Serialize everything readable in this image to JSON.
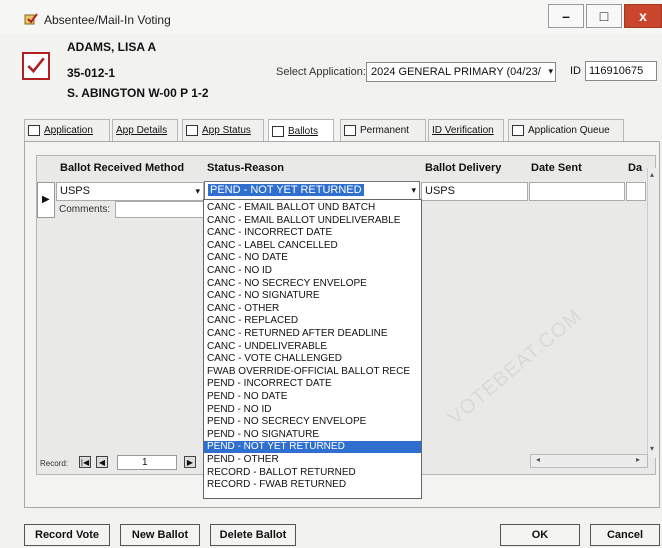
{
  "window": {
    "title": "Absentee/Mail-In Voting",
    "buttons": {
      "minimize": "–",
      "maximize": "□",
      "close": "x"
    }
  },
  "voter": {
    "name": "ADAMS, LISA A",
    "id": "35-012-1",
    "precinct": "S. ABINGTON W-00 P 1-2"
  },
  "application": {
    "select_label": "Select Application:",
    "selected": "2024 GENERAL PRIMARY (04/23/",
    "id_label": "ID",
    "id_value": "116910675"
  },
  "tabs": [
    {
      "label": "Application"
    },
    {
      "label": "App Details"
    },
    {
      "label": "App Status"
    },
    {
      "label": "Ballots"
    },
    {
      "label": "Permanent"
    },
    {
      "label": "ID Verification"
    },
    {
      "label": "Application Queue"
    }
  ],
  "grid": {
    "headers": [
      "Ballot Received Method",
      "Status-Reason",
      "Ballot Delivery",
      "Date Sent",
      "Da"
    ],
    "row": {
      "received_method": "USPS",
      "status_reason": "PEND - NOT YET RETURNED",
      "ballot_delivery": "USPS",
      "comments_label": "Comments:"
    }
  },
  "dropdown": {
    "items": [
      "CANC - EMAIL BALLOT UND BATCH",
      "CANC - EMAIL BALLOT UNDELIVERABLE",
      "CANC - INCORRECT DATE",
      "CANC - LABEL CANCELLED",
      "CANC - NO DATE",
      "CANC - NO ID",
      "CANC - NO SECRECY ENVELOPE",
      "CANC - NO SIGNATURE",
      "CANC - OTHER",
      "CANC - REPLACED",
      "CANC - RETURNED AFTER DEADLINE",
      "CANC - UNDELIVERABLE",
      "CANC - VOTE CHALLENGED",
      "FWAB OVERRIDE-OFFICIAL BALLOT RECE",
      "PEND - INCORRECT DATE",
      "PEND - NO DATE",
      "PEND - NO ID",
      "PEND - NO SECRECY ENVELOPE",
      "PEND - NO SIGNATURE",
      "PEND - NOT YET RETURNED",
      "PEND - OTHER",
      "RECORD - BALLOT RETURNED",
      "RECORD - FWAB RETURNED"
    ],
    "selected_index": 19
  },
  "record_nav": {
    "label": "Record:",
    "value": "1"
  },
  "footer": {
    "record_vote": "Record Vote",
    "new_ballot": "New Ballot",
    "delete_ballot": "Delete Ballot",
    "ok": "OK",
    "cancel": "Cancel"
  },
  "watermark": "VOTEBEAT.COM",
  "colors": {
    "selection": "#2f6fd0",
    "close_button": "#c9452b",
    "check_icon": "#b02020"
  }
}
